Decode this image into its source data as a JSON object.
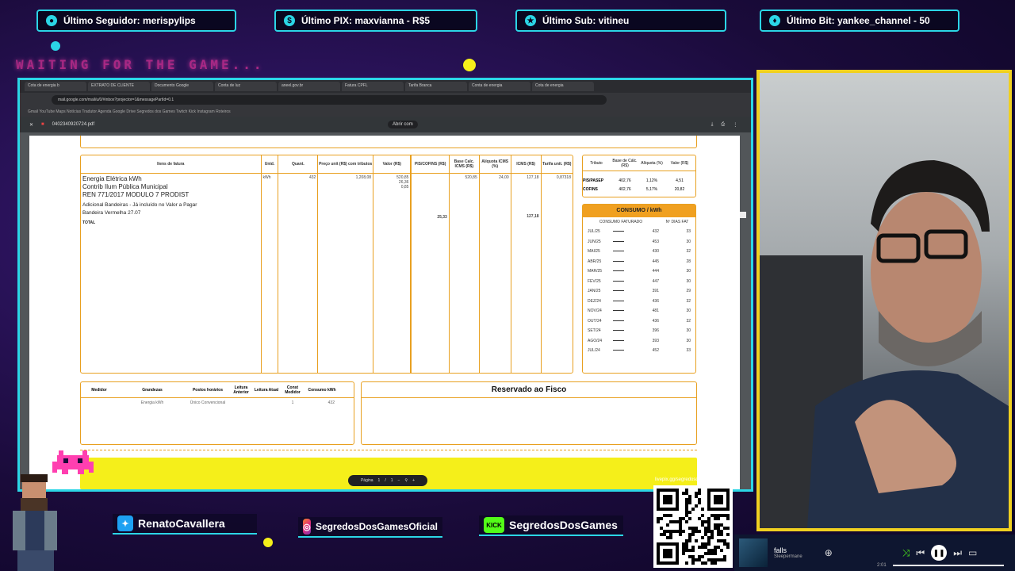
{
  "overlay": {
    "top_alerts": [
      {
        "label": "Último Seguidor: merispylips",
        "icon": "person-icon"
      },
      {
        "label": "Último PIX: maxvianna - R$5",
        "icon": "dollar-icon"
      },
      {
        "label": "Último Sub: vitineu",
        "icon": "star-icon"
      },
      {
        "label": "Último Bit: yankee_channel - 50",
        "icon": "diamond-icon"
      }
    ],
    "waiting_text": "WAITING FOR THE GAME...",
    "socials": [
      {
        "label": "RenatoCavallera",
        "icon": "twitter-icon"
      },
      {
        "label": "SegredosDosGamesOficial",
        "icon": "instagram-icon"
      },
      {
        "label": "SegredosDosGames",
        "icon": "kick-icon",
        "icon_text": "KICK"
      }
    ],
    "qr_label": "livepix.gg/segredosdosgames"
  },
  "browser": {
    "tabs": [
      "Cota de energia b",
      "EXTRATO DE CLIENTE",
      "Documento Google",
      "Conta de luz",
      "aneel.gov.br",
      "Fatura CPFL",
      "Tarifa Branca",
      "Conta de energia",
      "Cota de energia"
    ],
    "url": "mail.google.com/mail/u/0/#inbox?projector=1&messagePartId=0.1",
    "bookmarks": "Gmail  YouTube  Maps  Notícias  Tradutor  Agenda  Google Drive  Segredos dos Games  Twitch  Kick  Instagram  Roteiros",
    "pdf_name": "0402340920724.pdf",
    "pdf_zoom": "Abrir com"
  },
  "invoice": {
    "headers": [
      "Itens de fatura",
      "Unid.",
      "Quant.",
      "Preço unit (R$) com tributos",
      "Valor (R$)",
      "PIS/COFINS (R$)",
      "Base Calc. ICMS (R$)",
      "Alíquota ICMS (%)",
      "ICMS (R$)",
      "Tarifa unit. (R$)"
    ],
    "items": [
      "Energia Elétrica kWh",
      "Contrib Ilum Pública Municipal",
      "REN 771/2017 MODULO 7 PRODIST",
      "Adicional Bandeiras - Já incluído no Valor a Pagar",
      "Bandeira Vermelha 27.07"
    ],
    "total_label": "TOTAL",
    "unid": "kWh",
    "quant": "432",
    "preco": "1,208,08",
    "valor": [
      "520,85",
      "26,36",
      "0,85"
    ],
    "pis_total": "25,33",
    "base_icms": "520,85",
    "aliquota": "24,00",
    "icms": "127,18",
    "tarifa": "0,87318",
    "icms_total": "127,18"
  },
  "tributos": {
    "headers": [
      "Tributo",
      "Base de Cálc. (R$)",
      "Alíquota (%)",
      "Valor (R$)"
    ],
    "rows": [
      [
        "PIS/PASEP",
        "402,76",
        "1,12%",
        "4,51"
      ],
      [
        "COFINS",
        "402,76",
        "5,17%",
        "20,82"
      ]
    ]
  },
  "consumo": {
    "title": "CONSUMO / kWh",
    "headers": [
      "CONSUMO FATURADO",
      "Nº DIAS FAT"
    ],
    "rows": [
      [
        "JUL/25",
        "432",
        "33"
      ],
      [
        "JUN/25",
        "453",
        "30"
      ],
      [
        "MAI/25",
        "430",
        "32"
      ],
      [
        "ABR/25",
        "445",
        "28"
      ],
      [
        "MAR/25",
        "444",
        "30"
      ],
      [
        "FEV/25",
        "447",
        "30"
      ],
      [
        "JAN/25",
        "391",
        "29"
      ],
      [
        "DEZ/24",
        "436",
        "32"
      ],
      [
        "NOV/24",
        "481",
        "30"
      ],
      [
        "OUT/24",
        "436",
        "32"
      ],
      [
        "SET/24",
        "396",
        "30"
      ],
      [
        "AGO/24",
        "393",
        "30"
      ],
      [
        "JUL/24",
        "452",
        "33"
      ]
    ]
  },
  "medidor": {
    "headers": [
      "Medidor",
      "Grandezas",
      "Postos horários",
      "Leitura Anterior",
      "Leitura Atual",
      "Const Medidor",
      "Consumo kWh"
    ],
    "row": [
      "",
      "Energia kWh",
      "Único Convencional",
      "",
      "",
      "1",
      "432"
    ]
  },
  "fisco_title": "Reservado ao Fisco",
  "pager": {
    "label": "Página",
    "current": "1",
    "sep": "/",
    "total": "1"
  },
  "music": {
    "title": "falls",
    "artist": "Sleepermane",
    "time": "2:01"
  }
}
